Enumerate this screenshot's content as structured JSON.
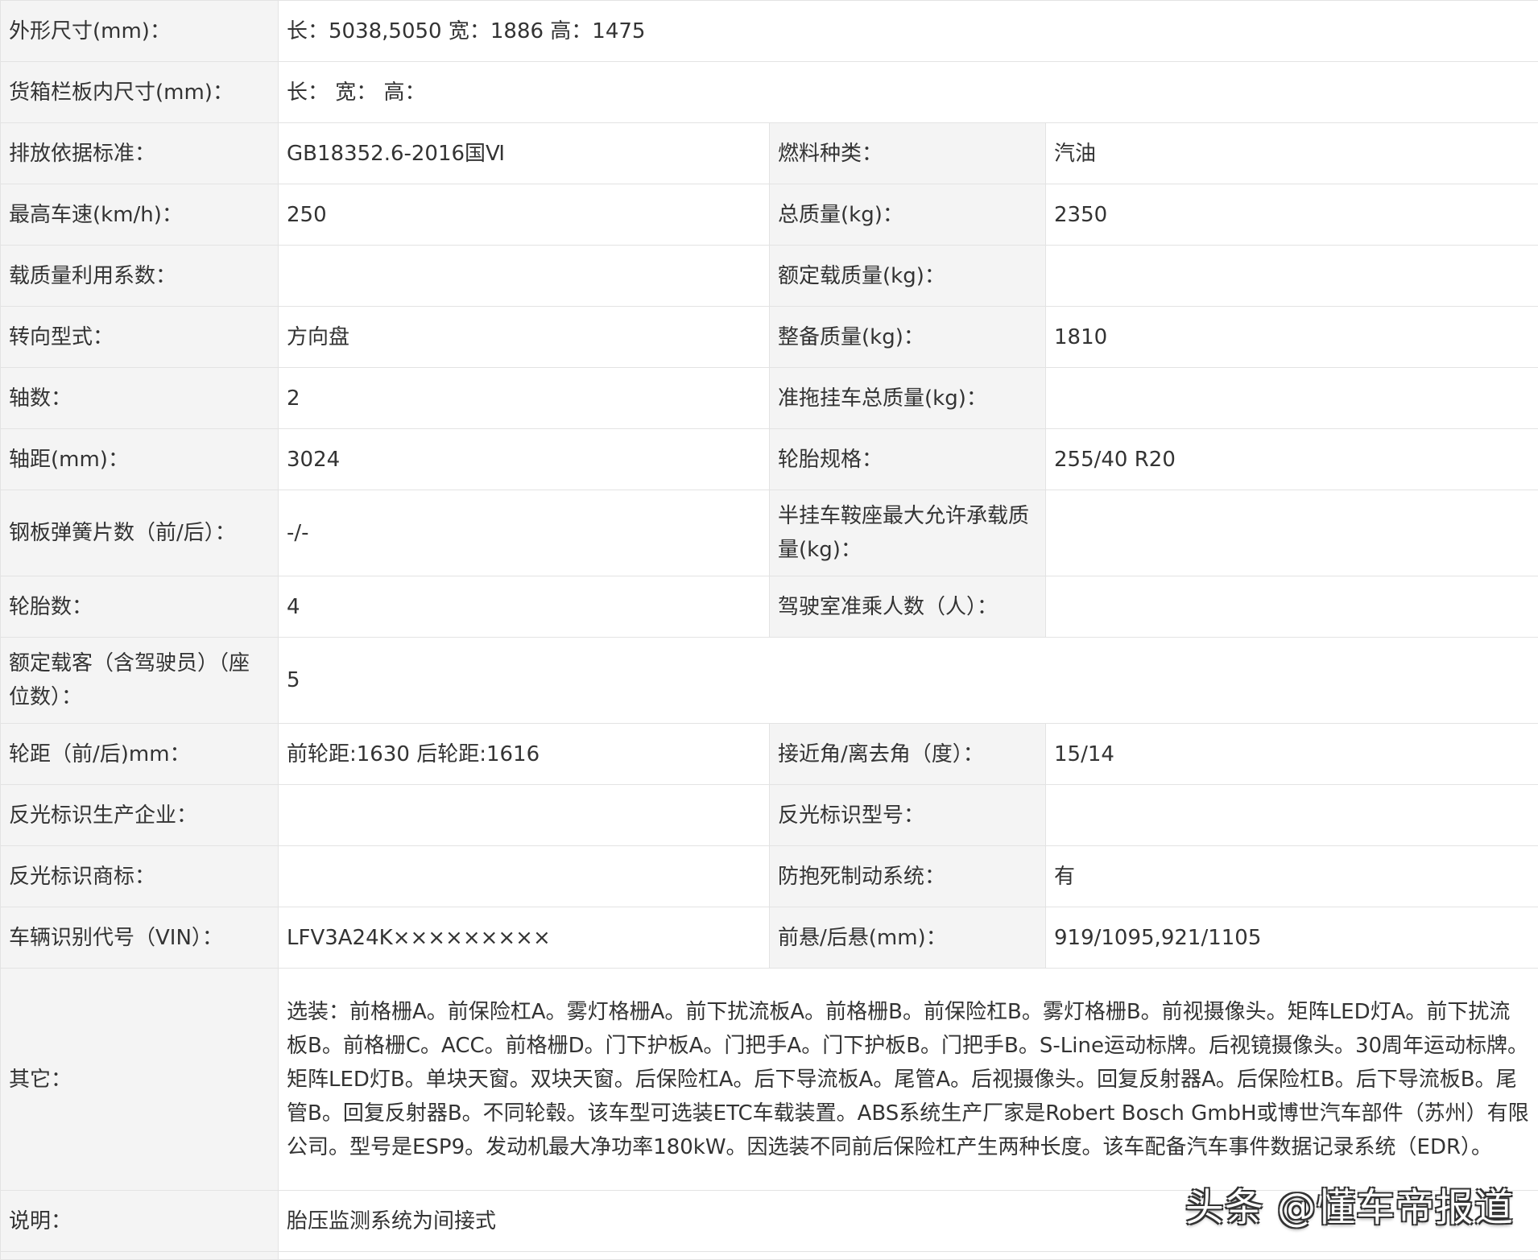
{
  "rows": [
    {
      "l1": "外形尺寸(mm)：",
      "v1": "长：5038,5050 宽：1886 高：1475"
    },
    {
      "l1": "货箱栏板内尺寸(mm)：",
      "v1": "长：   宽：   高："
    },
    {
      "l1": "排放依据标准：",
      "v1": "GB18352.6-2016国Ⅵ",
      "l2": "燃料种类：",
      "v2": "汽油"
    },
    {
      "l1": "最高车速(km/h)：",
      "v1": "250",
      "l2": "总质量(kg)：",
      "v2": "2350"
    },
    {
      "l1": "载质量利用系数：",
      "v1": "",
      "l2": "额定载质量(kg)：",
      "v2": ""
    },
    {
      "l1": "转向型式：",
      "v1": "方向盘",
      "l2": "整备质量(kg)：",
      "v2": "1810"
    },
    {
      "l1": "轴数：",
      "v1": "2",
      "l2": "准拖挂车总质量(kg)：",
      "v2": ""
    },
    {
      "l1": "轴距(mm)：",
      "v1": "3024",
      "l2": "轮胎规格：",
      "v2": "255/40 R20"
    },
    {
      "l1": "钢板弹簧片数（前/后）：",
      "v1": "-/-",
      "l2": "半挂车鞍座最大允许承载质量(kg)：",
      "v2": ""
    },
    {
      "l1": "轮胎数：",
      "v1": "4",
      "l2": "驾驶室准乘人数（人）：",
      "v2": ""
    },
    {
      "l1": "额定载客（含驾驶员）（座位数）：",
      "v1": "5"
    },
    {
      "l1": "轮距（前/后)mm：",
      "v1": "前轮距:1630 后轮距:1616",
      "l2": "接近角/离去角（度）：",
      "v2": "15/14"
    },
    {
      "l1": "反光标识生产企业：",
      "v1": "",
      "l2": "反光标识型号：",
      "v2": ""
    },
    {
      "l1": "反光标识商标：",
      "v1": "",
      "l2": "防抱死制动系统：",
      "v2": "有"
    },
    {
      "l1": "车辆识别代号（VIN）：",
      "v1": "LFV3A24K×××××××××",
      "l2": "前悬/后悬(mm)：",
      "v2": "919/1095,921/1105"
    },
    {
      "l1": "其它：",
      "v1": "选装：前格栅A。前保险杠A。雾灯格栅A。前下扰流板A。前格栅B。前保险杠B。雾灯格栅B。前视摄像头。矩阵LED灯A。前下扰流板B。前格栅C。ACC。前格栅D。门下护板A。门把手A。门下护板B。门把手B。S-Line运动标牌。后视镜摄像头。30周年运动标牌。矩阵LED灯B。单块天窗。双块天窗。后保险杠A。后下导流板A。尾管A。后视摄像头。回复反射器A。后保险杠B。后下导流板B。尾管B。回复反射器B。不同轮毂。该车型可选装ETC车载装置。ABS系统生产厂家是Robert Bosch GmbH或博世汽车部件（苏州）有限公司。型号是ESP9。发动机最大净功率180kW。因选装不同前后保险杠产生两种长度。该车配备汽车事件数据记录系统（EDR）。"
    },
    {
      "l1": "说明：",
      "v1": "胎压监测系统为间接式"
    }
  ],
  "watermark": "头条 @懂车帝报道"
}
